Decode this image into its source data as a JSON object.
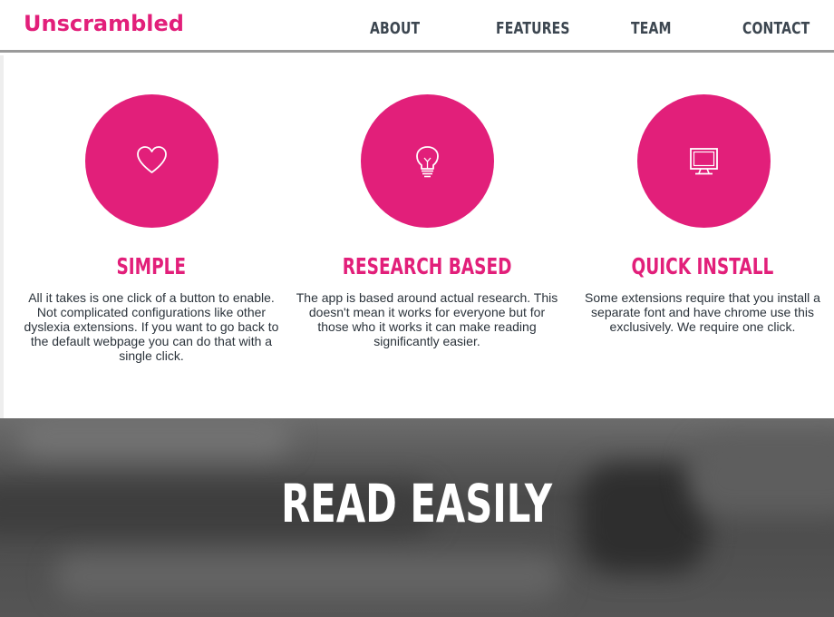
{
  "header": {
    "brand": "Unscrambled",
    "nav": [
      "ABOUT",
      "FEATURES",
      "TEAM",
      "CONTACT"
    ]
  },
  "features": [
    {
      "icon": "heart-icon",
      "title": "SIMPLE",
      "lines": [
        "All it takes is one click of a button to enable.",
        "Not complicated configurations like other",
        "dyslexia extensions. If you want to go back to",
        "the default webpage you can do that with a",
        "single click."
      ]
    },
    {
      "icon": "lightbulb-icon",
      "title": "RESEARCH BASED",
      "lines": [
        "The app is based around actual research. This",
        "doesn't mean it works for everyone but for",
        "those who it works it can make reading",
        "significantly easier."
      ]
    },
    {
      "icon": "monitor-icon",
      "title": "QUICK INSTALL",
      "lines": [
        "Some extensions require that you install a",
        "separate font and have chrome use this",
        "exclusively. We require one click."
      ]
    }
  ],
  "hero": {
    "title": "READ EASILY"
  },
  "colors": {
    "accent": "#e21f7a",
    "nav_text": "#3c4650",
    "body_text": "#2b333b"
  }
}
